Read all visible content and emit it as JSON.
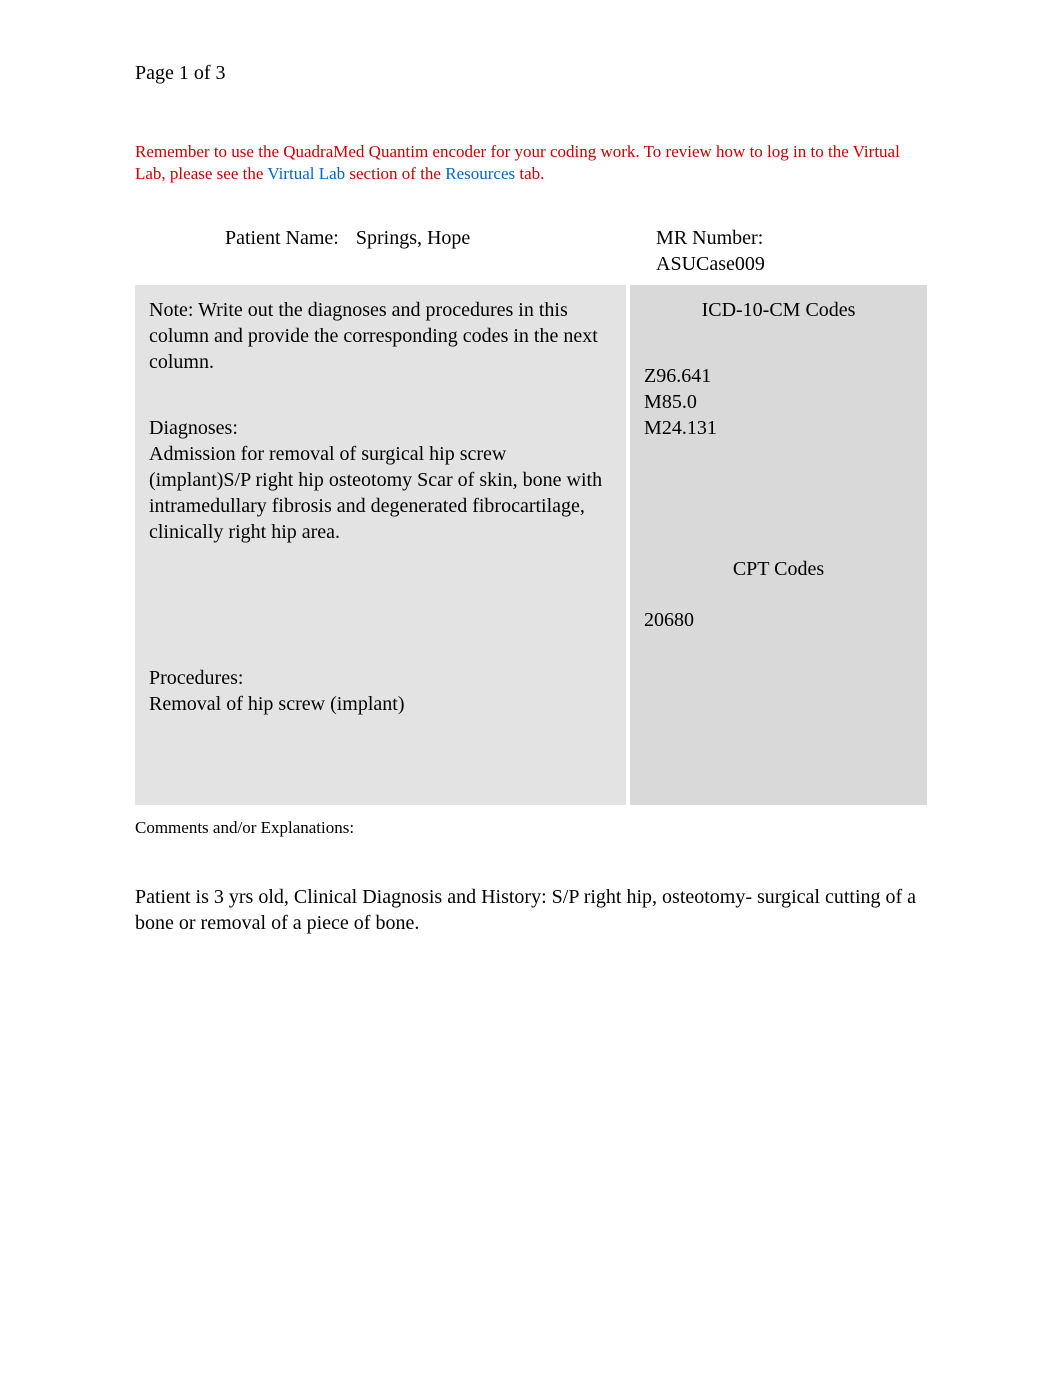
{
  "page_indicator": "Page 1 of 3",
  "instruction": {
    "part1": "Remember to use the QuadraMed Quantim encoder for your coding work. To review how to log in to the Virtual Lab, please see the ",
    "link1": "Virtual Lab",
    "part2": " section of the ",
    "link2": "Resources",
    "part3": " tab."
  },
  "header": {
    "patient_label": "Patient Name:",
    "patient_name": "Springs, Hope",
    "mr_label": "MR Number:",
    "mr_number": "ASUCase009"
  },
  "left_col": {
    "note": "Note: Write out the diagnoses and procedures in this column and provide the corresponding codes in the next column.",
    "diagnoses_heading": "Diagnoses:",
    "diagnoses_text": "Admission for removal of surgical hip screw (implant)S/P right hip osteotomy Scar of skin, bone with intramedullary fibrosis and degenerated fibrocartilage, clinically right hip area.",
    "procedures_heading": "Procedures:",
    "procedures_text": "Removal of hip screw (implant)"
  },
  "right_col": {
    "icd_heading": "ICD-10-CM Codes",
    "icd_codes": [
      "Z96.641",
      "M85.0",
      "M24.131"
    ],
    "cpt_heading": "CPT Codes",
    "cpt_codes": [
      "20680"
    ]
  },
  "comments": {
    "label": "Comments and/or Explanations:",
    "body": "Patient is 3 yrs old, Clinical Diagnosis and History: S/P right hip, osteotomy- surgical cutting of a bone or removal of a piece of bone."
  }
}
